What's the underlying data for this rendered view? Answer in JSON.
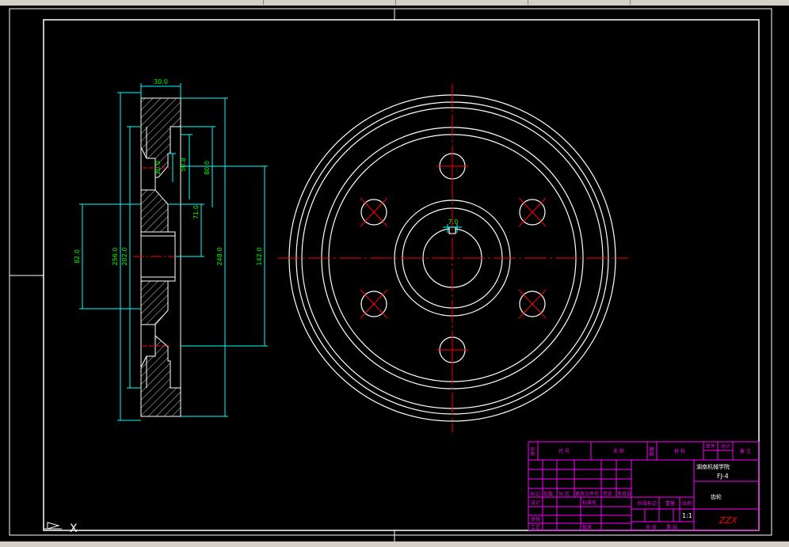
{
  "dimensions": {
    "width_top": "30.0",
    "d_20": "20.0",
    "d_50": "50.8",
    "d_80": "80.0",
    "d_71": "71.0",
    "d_82": "82.0",
    "d_256": "256.0",
    "d_202": "202.0",
    "d_248": "248.0",
    "d_142": "142.0",
    "keyway": "7.0"
  },
  "title_block": {
    "school": "湖南机械学院",
    "code": "FJ-4",
    "part": "齿轮",
    "ratio": "1:1",
    "author": "ZZX",
    "h_mark": "标记",
    "h_count": "处数",
    "h_zone": "分 区",
    "h_change": "更改文件号",
    "h_sign": "签名",
    "h_date": "年月日",
    "h_design": "设计",
    "h_std": "标准化",
    "h_review": "审核",
    "h_process": "工艺",
    "h_approve": "批准",
    "h_stage": "阶段标记",
    "h_weight": "重量",
    "h_scale": "比例",
    "h_sheets": "共 张",
    "h_sheet": "第 张",
    "h_seq": "序号",
    "h_code": "代 号",
    "h_name": "名 称",
    "h_qty": "数量",
    "h_mat": "材 料",
    "h_unit": "单件",
    "h_total": "总计",
    "h_note": "备 注"
  },
  "colors": {
    "outline": "#ffffff",
    "dimension": "#00ffff",
    "dim_text": "#00ff00",
    "center": "#ff0000",
    "title": "#ff00ff",
    "hatch": "#ffffff",
    "ucs": "#ffffff"
  },
  "ucs_label": "X"
}
